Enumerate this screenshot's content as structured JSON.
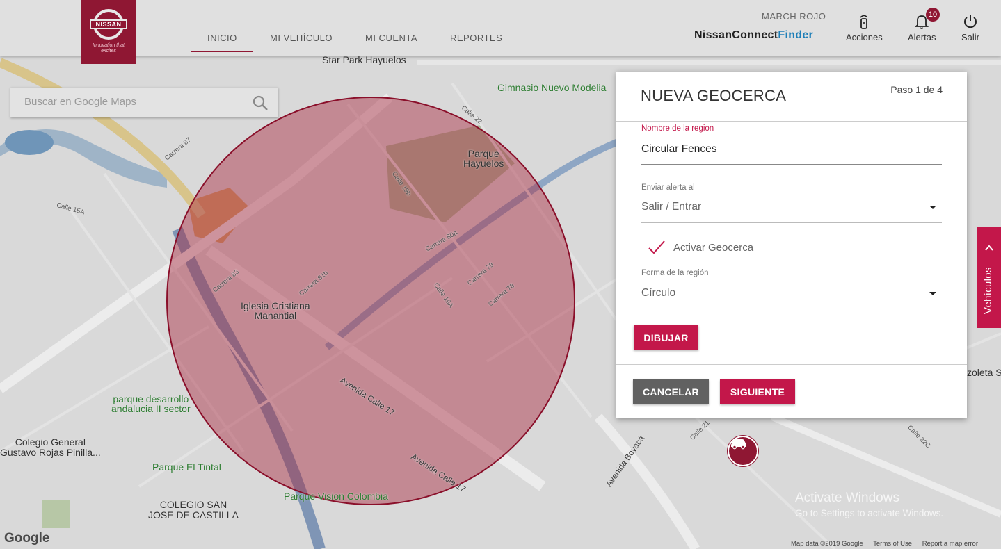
{
  "header": {
    "logo": {
      "brand": "NISSAN",
      "tagline": "Innovation that excites"
    },
    "nav": [
      {
        "label": "INICIO",
        "active": true
      },
      {
        "label": "MI VEHÍCULO",
        "active": false
      },
      {
        "label": "MI CUENTA",
        "active": false
      },
      {
        "label": "REPORTES",
        "active": false
      }
    ],
    "user_name": "MARCH ROJO",
    "brand_text": {
      "main": "NissanConnect",
      "sub": "Finder"
    },
    "actions": [
      {
        "label": "Acciones",
        "icon": "remote-key-icon"
      },
      {
        "label": "Alertas",
        "icon": "bell-icon",
        "badge": "10"
      },
      {
        "label": "Salir",
        "icon": "power-icon"
      }
    ]
  },
  "search": {
    "placeholder": "Buscar en Google Maps",
    "icon": "search-icon"
  },
  "map": {
    "labels": {
      "star_park": "Star Park Hayuelos",
      "gimnasio": "Gimnasio Nuevo Modelia",
      "parque_hayuelos": "Parque\nHayuelos",
      "iglesia": "Iglesia Cristiana\nManantial",
      "parque_desarrollo": "parque desarrollo\nandalucia II sector",
      "colegio_general": "Colegio General\nGustavo Rojas Pinilla...",
      "parque_tintal": "Parque El Tintal",
      "parque_vision": "Parque Vision Colombia",
      "colegio_san_jose": "COLEGIO SAN\nJOSE DE CASTILLA",
      "avenida_calle_17a": "Avenida Calle 17",
      "avenida_calle_17b": "Avenida Calle 17",
      "avenida_boyaca": "Avenida Boyacá",
      "calle_15a": "Calle 15A",
      "calle_22": "Calle 22",
      "calle_22c": "Calle 22C",
      "carrera_80a": "Carrera 80a",
      "zoleta": "zoleta S",
      "carrera_87": "Carrera 87",
      "carrera_83": "Carrera 83",
      "carrera_81b": "Carrera 81b",
      "carrera_79": "Carrera 79",
      "carrera_78": "Carrera 78",
      "calle_19a": "Calle 19A",
      "calle_21": "Calle 21",
      "calle_19b": "Calle 19b"
    },
    "google_logo": "Google",
    "footer": [
      "Map data ©2019 Google",
      "Terms of Use",
      "Report a map error"
    ],
    "geofence": {
      "shape": "circle",
      "fill": "#a8283f",
      "stroke": "#8a0f2a"
    },
    "vehicle_marker": "car-icon"
  },
  "panel": {
    "title": "NUEVA GEOCERCA",
    "step": "Paso 1 de 4",
    "region_name_label": "Nombre de la region",
    "region_name_value": "Circular Fences",
    "alert_label": "Enviar alerta al",
    "alert_value": "Salir / Entrar",
    "activate_label": "Activar Geocerca",
    "activate_checked": true,
    "shape_label": "Forma de la región",
    "shape_value": "Círculo",
    "draw_button": "DIBUJAR",
    "cancel_button": "CANCELAR",
    "next_button": "SIGUIENTE"
  },
  "side_tab": {
    "label": "Vehículos"
  },
  "watermark": {
    "title": "Activate Windows",
    "subtitle": "Go to Settings to activate Windows."
  },
  "colors": {
    "accent": "#c3174a",
    "brand_dark": "#8f1733",
    "cancel_gray": "#616161"
  }
}
